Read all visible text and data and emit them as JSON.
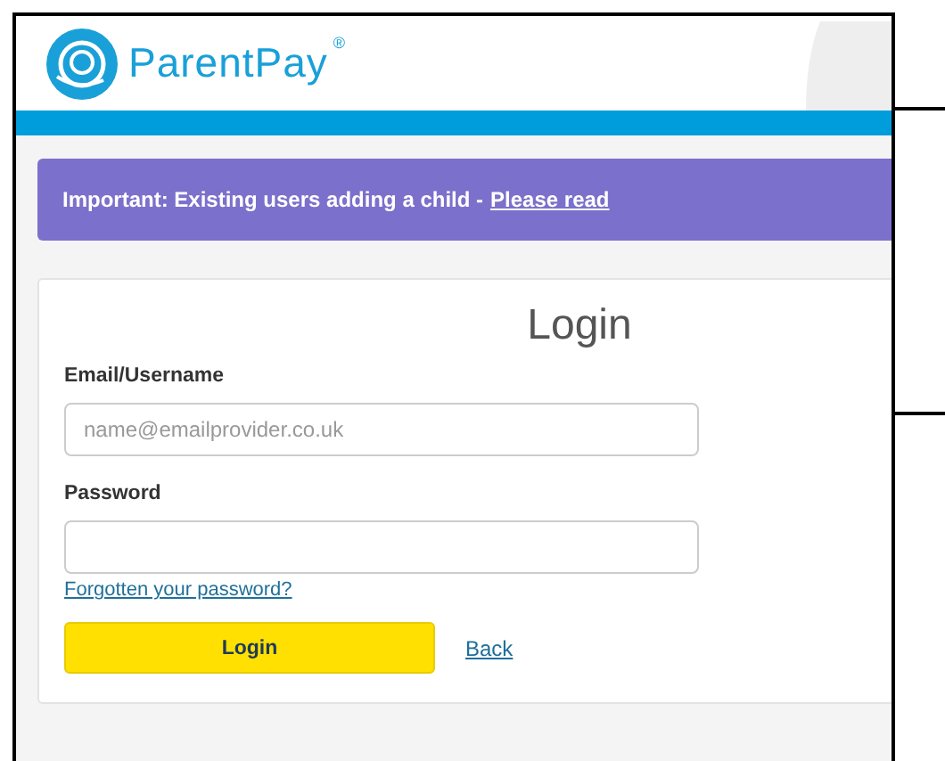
{
  "header": {
    "brand": "ParentPay",
    "registered_mark": "®"
  },
  "notice": {
    "text": "Important: Existing users adding a child - ",
    "link": "Please read"
  },
  "login": {
    "title": "Login",
    "fields": [
      {
        "label": "Email/Username",
        "placeholder": "name@emailprovider.co.uk"
      },
      {
        "label": "Password"
      }
    ],
    "forgot_link": "Forgotten your password?",
    "submit": "Login",
    "back": "Back"
  }
}
